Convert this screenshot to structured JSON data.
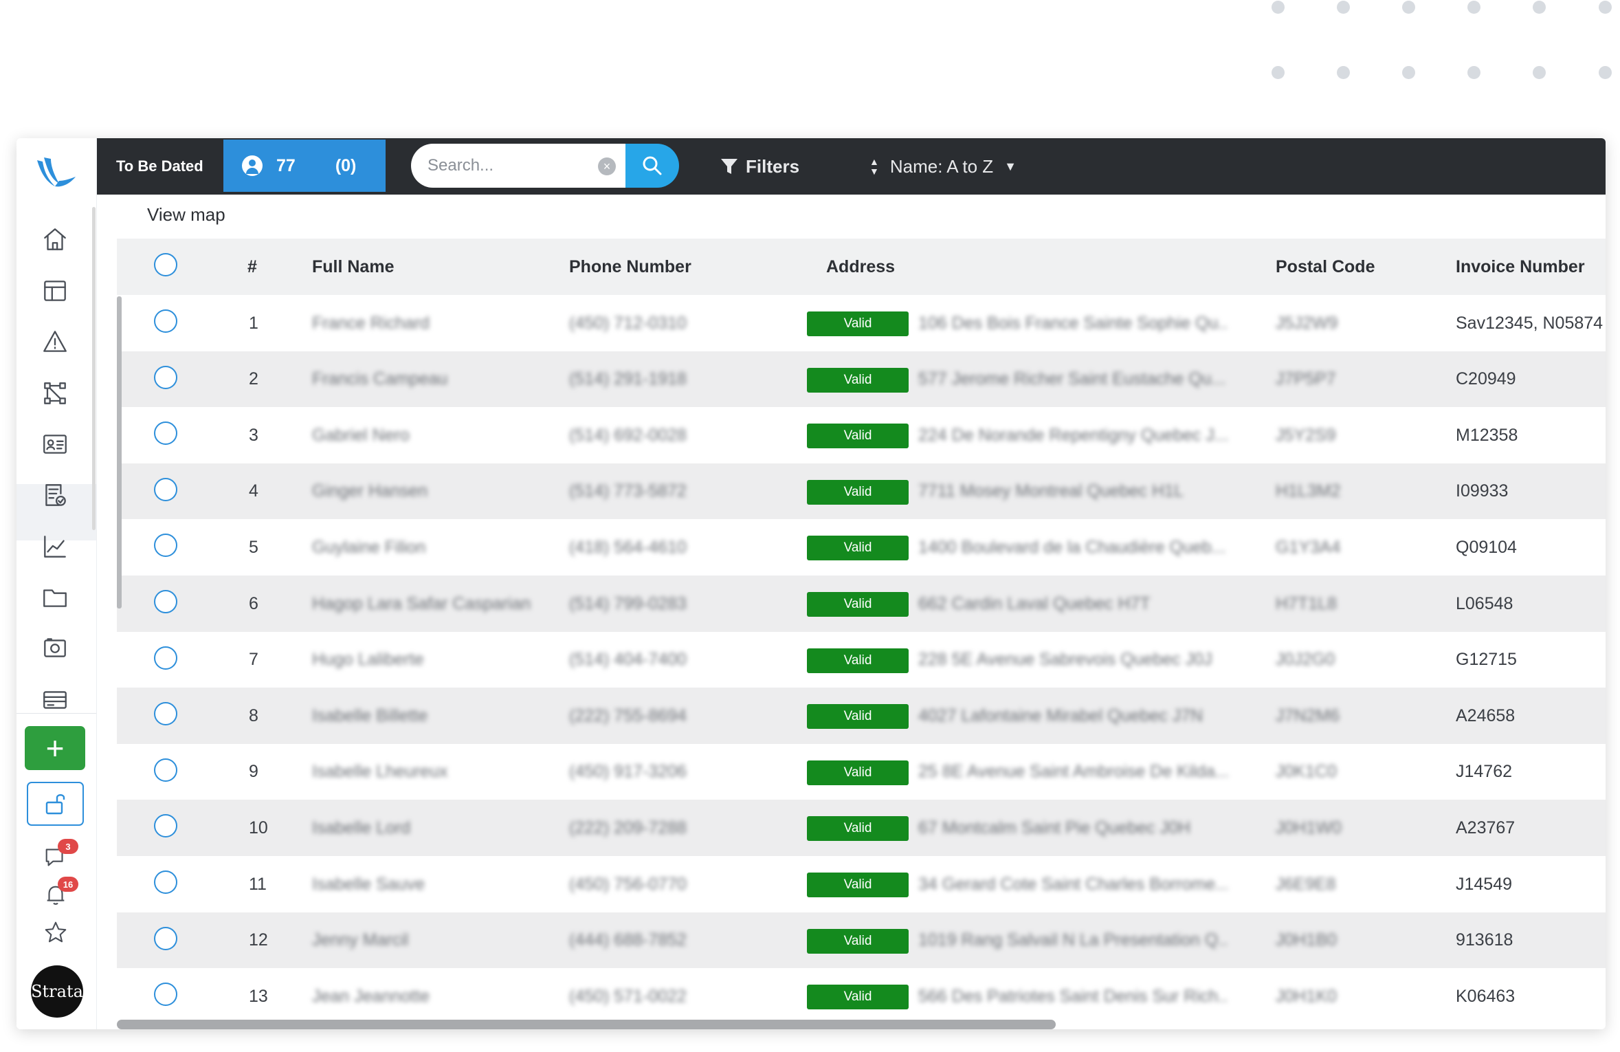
{
  "toolbar": {
    "view_title": "To Be Dated",
    "count": "77",
    "sub_count": "(0)",
    "search_placeholder": "Search...",
    "filters_label": "Filters",
    "sort_label": "Name: A to Z"
  },
  "view_map_label": "View map",
  "sidebar": {
    "items": [
      "home-icon",
      "dashboard-icon",
      "alert-icon",
      "workflow-icon",
      "contacts-icon",
      "orders-icon",
      "analytics-icon",
      "folder-icon",
      "camera-icon",
      "billing-icon"
    ],
    "messages_badge": "3",
    "notifications_badge": "16",
    "avatar_label": "Strata"
  },
  "table": {
    "columns": [
      "#",
      "Full Name",
      "Phone Number",
      "Address",
      "Postal Code",
      "Invoice Number"
    ],
    "status_label": "Valid",
    "rows": [
      {
        "num": "1",
        "name": "France Richard",
        "phone": "(450) 712-0310",
        "address": "106 Des Bois France Sainte Sophie Qu...",
        "postal": "J5J2W9",
        "invoice": "Sav12345, N05874"
      },
      {
        "num": "2",
        "name": "Francis Campeau",
        "phone": "(514) 291-1918",
        "address": "577 Jerome Richer Saint Eustache Qu...",
        "postal": "J7P5P7",
        "invoice": "C20949"
      },
      {
        "num": "3",
        "name": "Gabriel Nero",
        "phone": "(514) 692-0028",
        "address": "224 De Norande Repentigny Quebec J...",
        "postal": "J5Y2S9",
        "invoice": "M12358"
      },
      {
        "num": "4",
        "name": "Ginger Hansen",
        "phone": "(514) 773-5872",
        "address": "7711 Mosey Montreal Quebec H1L",
        "postal": "H1L3M2",
        "invoice": "I09933"
      },
      {
        "num": "5",
        "name": "Guylaine Filion",
        "phone": "(418) 564-4610",
        "address": "1400 Boulevard de la Chaudière Queb...",
        "postal": "G1Y3A4",
        "invoice": "Q09104"
      },
      {
        "num": "6",
        "name": "Hagop Lara Safar Casparian",
        "phone": "(514) 799-0283",
        "address": "662 Cardin Laval Quebec H7T",
        "postal": "H7T1L8",
        "invoice": "L06548"
      },
      {
        "num": "7",
        "name": "Hugo Laliberte",
        "phone": "(514) 404-7400",
        "address": "228 5E Avenue Sabrevois Quebec J0J",
        "postal": "J0J2G0",
        "invoice": "G12715"
      },
      {
        "num": "8",
        "name": "Isabelle Billette",
        "phone": "(222) 755-8694",
        "address": "4027 Lafontaine Mirabel Quebec J7N",
        "postal": "J7N2M6",
        "invoice": "A24658"
      },
      {
        "num": "9",
        "name": "Isabelle Lheureux",
        "phone": "(450) 917-3206",
        "address": "25 8E Avenue Saint Ambroise De Kilda...",
        "postal": "J0K1C0",
        "invoice": "J14762"
      },
      {
        "num": "10",
        "name": "Isabelle Lord",
        "phone": "(222) 209-7288",
        "address": "67 Montcalm Saint Pie Quebec J0H",
        "postal": "J0H1W0",
        "invoice": "A23767"
      },
      {
        "num": "11",
        "name": "Isabelle Sauve",
        "phone": "(450) 756-0770",
        "address": "34 Gerard Cote Saint Charles Borrome...",
        "postal": "J6E9E8",
        "invoice": "J14549"
      },
      {
        "num": "12",
        "name": "Jenny Marcil",
        "phone": "(444) 688-7852",
        "address": "1019 Rang Salvail N La Presentation Q...",
        "postal": "J0H1B0",
        "invoice": "913618"
      },
      {
        "num": "13",
        "name": "Jean Jeannotte",
        "phone": "(450) 571-0022",
        "address": "566 Des Patriotes Saint Denis Sur Rich...",
        "postal": "J0H1K0",
        "invoice": "K06463"
      }
    ]
  },
  "colors": {
    "accent": "#2d8fdb",
    "topbar": "#2a2d31",
    "valid": "#148a1e",
    "add": "#2e9e3e"
  }
}
